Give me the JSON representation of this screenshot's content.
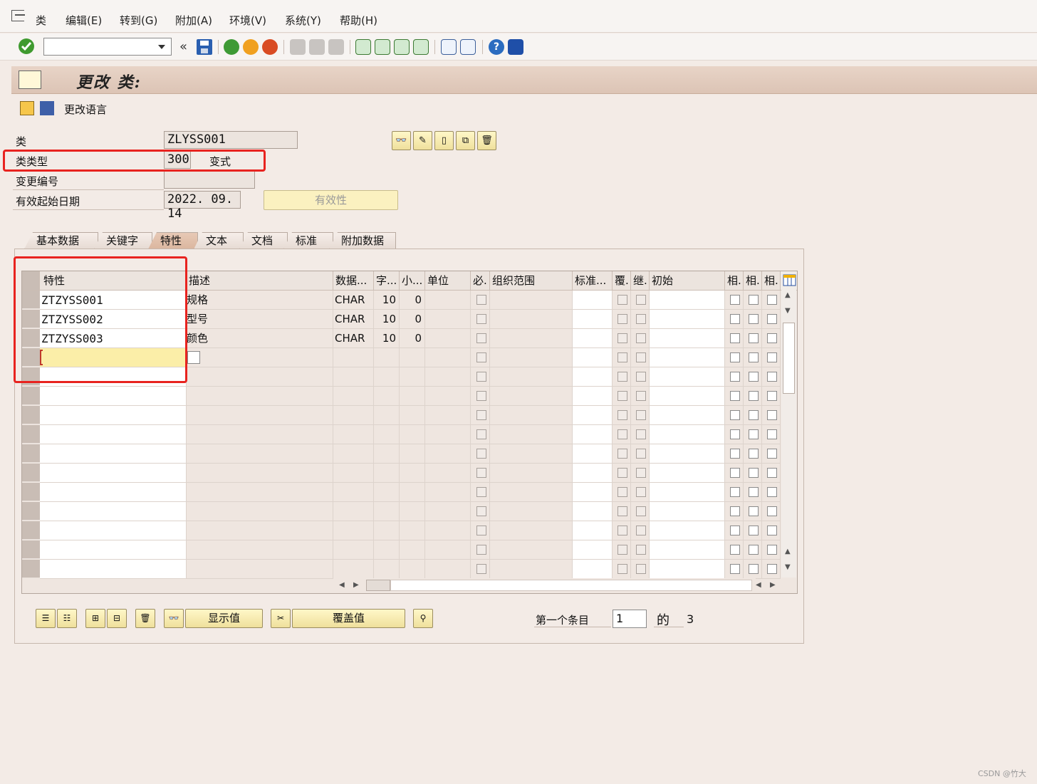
{
  "menu": [
    "类",
    "编辑(E)",
    "转到(G)",
    "附加(A)",
    "环境(V)",
    "系统(Y)",
    "帮助(H)"
  ],
  "title": "更改 类:",
  "app_toolbar": {
    "change_language": "更改语言"
  },
  "header": {
    "class_label": "类",
    "class_value": "ZLYSS001",
    "class_type_label": "类类型",
    "class_type_value": "300",
    "class_type_text": "变式",
    "change_number_label": "变更编号",
    "change_number_value": "",
    "valid_from_label": "有效起始日期",
    "valid_from_value": "2022. 09. 14",
    "validity_button": "有效性"
  },
  "tabs": [
    "基本数据",
    "关键字",
    "特性",
    "文本",
    "文档",
    "标准",
    "附加数据"
  ],
  "active_tab": 2,
  "table": {
    "columns": [
      "特性",
      "描述",
      "数据...",
      "字...",
      "小...",
      "单位",
      "必.",
      "组织范围",
      "标准...",
      "覆.",
      "继.",
      "初始",
      "相.",
      "相.",
      "相."
    ],
    "rows": [
      {
        "char": "ZTZYSS001",
        "desc": "规格",
        "type": "CHAR",
        "len": "10",
        "dec": "0"
      },
      {
        "char": "ZTZYSS002",
        "desc": "型号",
        "type": "CHAR",
        "len": "10",
        "dec": "0"
      },
      {
        "char": "ZTZYSS003",
        "desc": "颜色",
        "type": "CHAR",
        "len": "10",
        "dec": "0"
      }
    ]
  },
  "buttons": {
    "show_values": "显示值",
    "override_values": "覆盖值"
  },
  "footer": {
    "first_entry_label": "第一个条目",
    "first_entry_value": "1",
    "of_label": "的",
    "total": "3"
  },
  "watermark": "CSDN @竹大",
  "colors": {
    "highlight": "#e8231f",
    "title_bar": "#dcc4b5",
    "button_yellow": "#f5e9a8"
  }
}
